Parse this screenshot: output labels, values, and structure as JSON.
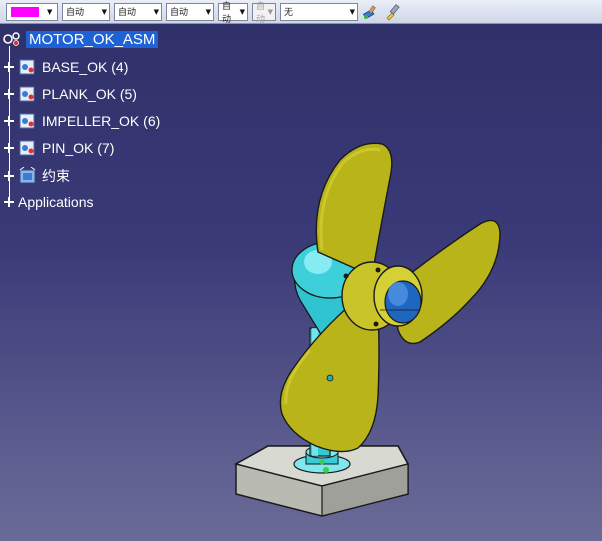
{
  "toolbar": {
    "color": "#ff00ff",
    "line_weight": "自动",
    "line_type": "自动",
    "point_style": "自动",
    "layer": "自动",
    "disabled_combo": "自动",
    "render": "无",
    "icons": [
      "paint-painter-icon",
      "properties-brush-icon"
    ]
  },
  "tree": {
    "root": "MOTOR_OK_ASM",
    "items": [
      {
        "label": "BASE_OK (4)"
      },
      {
        "label": "PLANK_OK (5)"
      },
      {
        "label": "IMPELLER_OK (6)"
      },
      {
        "label": "PIN_OK (7)"
      }
    ],
    "constraints": "约束",
    "applications": "Applications"
  }
}
